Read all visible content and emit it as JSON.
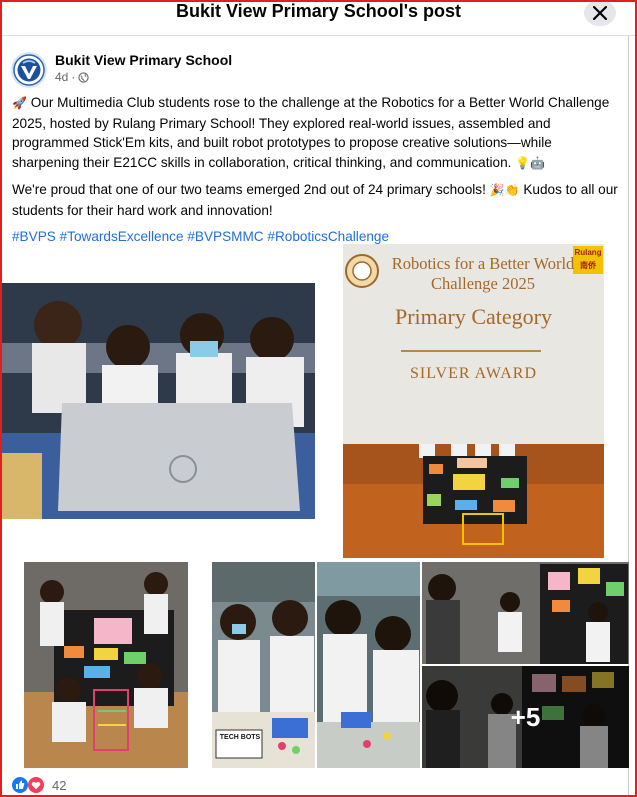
{
  "header": {
    "title": "Bukit View Primary School's post",
    "close_icon": "close-icon"
  },
  "post": {
    "author": "Bukit View Primary School",
    "time": "4d",
    "separator": "·",
    "audience_icon": "globe-icon",
    "paragraph1": "Our Multimedia Club students rose to the challenge at the Robotics for a Better World Challenge 2025, hosted by Rulang Primary School! They explored real-world issues, assembled and programmed Stick'Em kits, and built robot prototypes to propose creative solutions—while sharpening their E21CC skills in collaboration, critical thinking, and communication.",
    "paragraph2": "We're proud that one of our two teams emerged 2nd out of 24 primary schools!",
    "paragraph2b": "Kudos to all our students for their hard work and innovation!",
    "hashtags": [
      "#BVPS",
      "#TowardsExcellence",
      "#BVPSMMC",
      "#RoboticsChallenge"
    ]
  },
  "photos": {
    "banner_line1": "Robotics for a Better World",
    "banner_line2": "Challenge 2025",
    "banner_category": "Primary Category",
    "banner_award": "SILVER AWARD",
    "banner_badge_top": "Rulang",
    "banner_badge_bottom": "南侨",
    "sign_text": "TECH BOTS",
    "more_count": "+5"
  },
  "reactions": {
    "count": "42",
    "icons": [
      "like-icon",
      "love-icon"
    ]
  },
  "colors": {
    "link": "#216fdb",
    "muted": "#65676b",
    "border": "#e02020"
  }
}
